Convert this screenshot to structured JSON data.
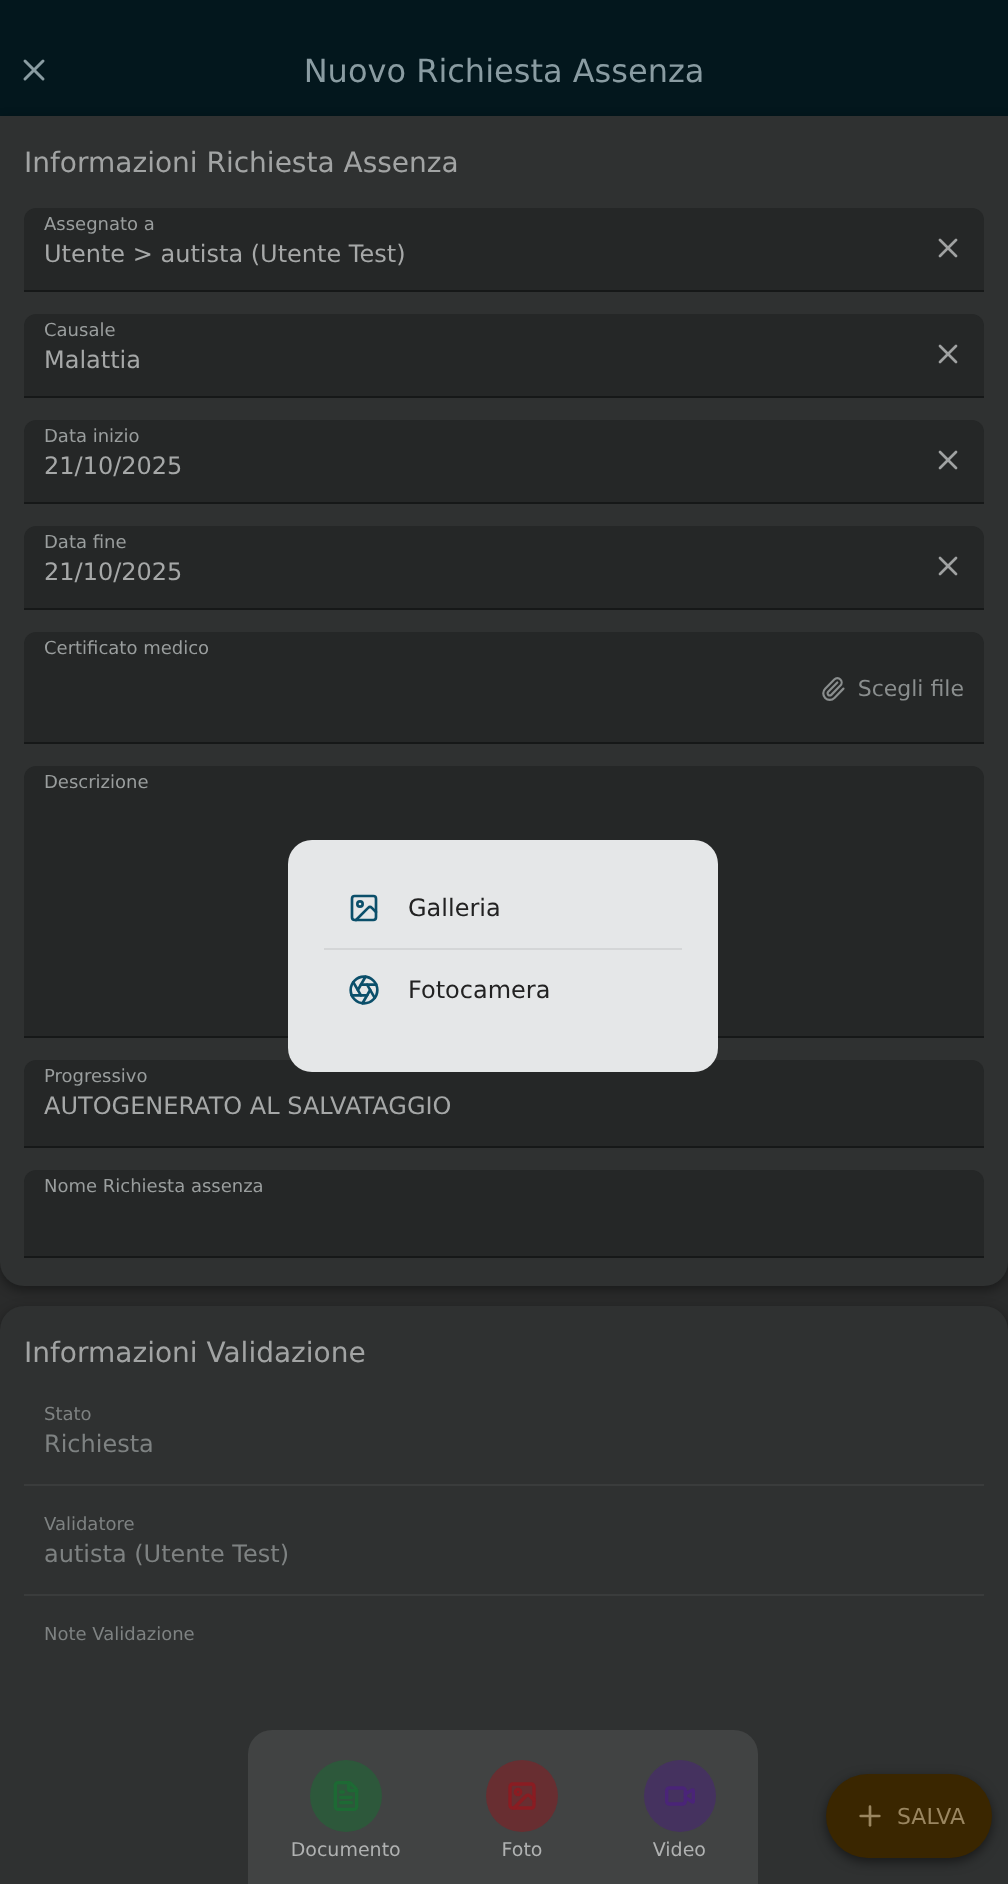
{
  "header": {
    "title": "Nuovo Richiesta Assenza"
  },
  "sections": [
    {
      "title": "Informazioni Richiesta Assenza",
      "fields": [
        {
          "kind": "clearable",
          "label": "Assegnato a",
          "value": "Utente > autista (Utente Test)",
          "disabled": false
        },
        {
          "kind": "clearable",
          "label": "Causale",
          "value": "Malattia",
          "disabled": false
        },
        {
          "kind": "clearable",
          "label": "Data inizio",
          "value": "21/10/2025",
          "disabled": false
        },
        {
          "kind": "clearable",
          "label": "Data fine",
          "value": "21/10/2025",
          "disabled": false
        },
        {
          "kind": "file",
          "label": "Certificato medico",
          "action": "Scegli file",
          "disabled": false
        },
        {
          "kind": "textarea",
          "label": "Descrizione",
          "disabled": false
        },
        {
          "kind": "text",
          "label": "Progressivo",
          "value": "AUTOGENERATO AL SALVATAGGIO",
          "disabled": false
        },
        {
          "kind": "text",
          "label": "Nome Richiesta assenza",
          "disabled": false
        }
      ]
    },
    {
      "title": "Informazioni Validazione",
      "fields": [
        {
          "kind": "text",
          "label": "Stato",
          "value": "Richiesta",
          "disabled": true
        },
        {
          "kind": "text",
          "label": "Validatore",
          "value": "autista (Utente Test)",
          "disabled": true
        },
        {
          "kind": "textarea",
          "label": "Note Validazione",
          "disabled": true
        }
      ]
    }
  ],
  "attach_sheet": {
    "items": [
      {
        "kind": "document",
        "label": "Documento",
        "color": "#1d6a34"
      },
      {
        "kind": "photo",
        "label": "Foto",
        "color": "#8a1c22"
      },
      {
        "kind": "video",
        "label": "Video",
        "color": "#4a2478"
      }
    ]
  },
  "save_button": {
    "label": "SALVA"
  },
  "popup": {
    "items": [
      {
        "kind": "gallery",
        "label": "Galleria"
      },
      {
        "kind": "camera",
        "label": "Fotocamera"
      }
    ]
  }
}
